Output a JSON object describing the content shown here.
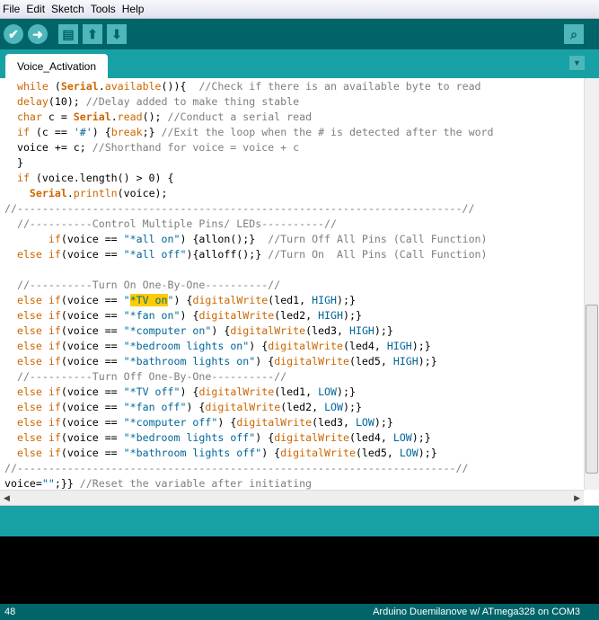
{
  "menu": [
    "File",
    "Edit",
    "Sketch",
    "Tools",
    "Help"
  ],
  "toolbar": {
    "verify": "✔",
    "upload": "➜",
    "new": "▤",
    "open": "⬆",
    "save": "⬇",
    "serial_monitor": "⌕"
  },
  "tab": {
    "label": "Voice_Activation",
    "menu_arrow": "▼"
  },
  "editor": {
    "lines": [
      [
        [
          "n",
          "  "
        ],
        [
          "k",
          "while"
        ],
        [
          "n",
          " ("
        ],
        [
          "b",
          "Serial"
        ],
        [
          "n",
          "."
        ],
        [
          "k",
          "available"
        ],
        [
          "n",
          "()){  "
        ],
        [
          "c",
          "//Check if there is an available byte to read"
        ]
      ],
      [
        [
          "n",
          "  "
        ],
        [
          "k",
          "delay"
        ],
        [
          "n",
          "(10); "
        ],
        [
          "c",
          "//Delay added to make thing stable"
        ]
      ],
      [
        [
          "n",
          "  "
        ],
        [
          "k",
          "char"
        ],
        [
          "n",
          " c = "
        ],
        [
          "b",
          "Serial"
        ],
        [
          "n",
          "."
        ],
        [
          "k",
          "read"
        ],
        [
          "n",
          "(); "
        ],
        [
          "c",
          "//Conduct a serial read"
        ]
      ],
      [
        [
          "n",
          "  "
        ],
        [
          "k",
          "if"
        ],
        [
          "n",
          " (c == "
        ],
        [
          "s",
          "'#'"
        ],
        [
          "n",
          ") {"
        ],
        [
          "k",
          "break"
        ],
        [
          "n",
          ";} "
        ],
        [
          "c",
          "//Exit the loop when the # is detected after the word"
        ]
      ],
      [
        [
          "n",
          "  voice += c; "
        ],
        [
          "c",
          "//Shorthand for voice = voice + c"
        ]
      ],
      [
        [
          "n",
          "  }"
        ]
      ],
      [
        [
          "n",
          "  "
        ],
        [
          "k",
          "if"
        ],
        [
          "n",
          " (voice.length() > 0) {"
        ]
      ],
      [
        [
          "n",
          "    "
        ],
        [
          "b",
          "Serial"
        ],
        [
          "n",
          "."
        ],
        [
          "k",
          "println"
        ],
        [
          "n",
          "(voice);"
        ]
      ],
      [
        [
          "c",
          "//-----------------------------------------------------------------------//"
        ]
      ],
      [
        [
          "n",
          "  "
        ],
        [
          "c",
          "//----------Control Multiple Pins/ LEDs----------//"
        ]
      ],
      [
        [
          "n",
          "       "
        ],
        [
          "k",
          "if"
        ],
        [
          "n",
          "(voice == "
        ],
        [
          "s",
          "\"*all on\""
        ],
        [
          "n",
          ") {allon();}  "
        ],
        [
          "c",
          "//Turn Off All Pins (Call Function)"
        ]
      ],
      [
        [
          "n",
          "  "
        ],
        [
          "k",
          "else if"
        ],
        [
          "n",
          "(voice == "
        ],
        [
          "s",
          "\"*all off\""
        ],
        [
          "n",
          "){alloff();} "
        ],
        [
          "c",
          "//Turn On  All Pins (Call Function)"
        ]
      ],
      [
        [
          "n",
          ""
        ]
      ],
      [
        [
          "n",
          "  "
        ],
        [
          "c",
          "//----------Turn On One-By-One----------//"
        ]
      ],
      [
        [
          "n",
          "  "
        ],
        [
          "k",
          "else if"
        ],
        [
          "n",
          "(voice == "
        ],
        [
          "s",
          "\""
        ],
        [
          "h",
          "*TV on"
        ],
        [
          "s",
          "\""
        ],
        [
          "n",
          ") {"
        ],
        [
          "k",
          "digitalWrite"
        ],
        [
          "n",
          "(led1, "
        ],
        [
          "s",
          "HIGH"
        ],
        [
          "n",
          ");}"
        ]
      ],
      [
        [
          "n",
          "  "
        ],
        [
          "k",
          "else if"
        ],
        [
          "n",
          "(voice == "
        ],
        [
          "s",
          "\"*fan on\""
        ],
        [
          "n",
          ") {"
        ],
        [
          "k",
          "digitalWrite"
        ],
        [
          "n",
          "(led2, "
        ],
        [
          "s",
          "HIGH"
        ],
        [
          "n",
          ");}"
        ]
      ],
      [
        [
          "n",
          "  "
        ],
        [
          "k",
          "else if"
        ],
        [
          "n",
          "(voice == "
        ],
        [
          "s",
          "\"*computer on\""
        ],
        [
          "n",
          ") {"
        ],
        [
          "k",
          "digitalWrite"
        ],
        [
          "n",
          "(led3, "
        ],
        [
          "s",
          "HIGH"
        ],
        [
          "n",
          ");}"
        ]
      ],
      [
        [
          "n",
          "  "
        ],
        [
          "k",
          "else if"
        ],
        [
          "n",
          "(voice == "
        ],
        [
          "s",
          "\"*bedroom lights on\""
        ],
        [
          "n",
          ") {"
        ],
        [
          "k",
          "digitalWrite"
        ],
        [
          "n",
          "(led4, "
        ],
        [
          "s",
          "HIGH"
        ],
        [
          "n",
          ");}"
        ]
      ],
      [
        [
          "n",
          "  "
        ],
        [
          "k",
          "else if"
        ],
        [
          "n",
          "(voice == "
        ],
        [
          "s",
          "\"*bathroom lights on\""
        ],
        [
          "n",
          ") {"
        ],
        [
          "k",
          "digitalWrite"
        ],
        [
          "n",
          "(led5, "
        ],
        [
          "s",
          "HIGH"
        ],
        [
          "n",
          ");}"
        ]
      ],
      [
        [
          "n",
          "  "
        ],
        [
          "c",
          "//----------Turn Off One-By-One----------//"
        ]
      ],
      [
        [
          "n",
          "  "
        ],
        [
          "k",
          "else if"
        ],
        [
          "n",
          "(voice == "
        ],
        [
          "s",
          "\"*TV off\""
        ],
        [
          "n",
          ") {"
        ],
        [
          "k",
          "digitalWrite"
        ],
        [
          "n",
          "(led1, "
        ],
        [
          "s",
          "LOW"
        ],
        [
          "n",
          ");}"
        ]
      ],
      [
        [
          "n",
          "  "
        ],
        [
          "k",
          "else if"
        ],
        [
          "n",
          "(voice == "
        ],
        [
          "s",
          "\"*fan off\""
        ],
        [
          "n",
          ") {"
        ],
        [
          "k",
          "digitalWrite"
        ],
        [
          "n",
          "(led2, "
        ],
        [
          "s",
          "LOW"
        ],
        [
          "n",
          ");}"
        ]
      ],
      [
        [
          "n",
          "  "
        ],
        [
          "k",
          "else if"
        ],
        [
          "n",
          "(voice == "
        ],
        [
          "s",
          "\"*computer off\""
        ],
        [
          "n",
          ") {"
        ],
        [
          "k",
          "digitalWrite"
        ],
        [
          "n",
          "(led3, "
        ],
        [
          "s",
          "LOW"
        ],
        [
          "n",
          ");}"
        ]
      ],
      [
        [
          "n",
          "  "
        ],
        [
          "k",
          "else if"
        ],
        [
          "n",
          "(voice == "
        ],
        [
          "s",
          "\"*bedroom lights off\""
        ],
        [
          "n",
          ") {"
        ],
        [
          "k",
          "digitalWrite"
        ],
        [
          "n",
          "(led4, "
        ],
        [
          "s",
          "LOW"
        ],
        [
          "n",
          ");}"
        ]
      ],
      [
        [
          "n",
          "  "
        ],
        [
          "k",
          "else if"
        ],
        [
          "n",
          "(voice == "
        ],
        [
          "s",
          "\"*bathroom lights off\""
        ],
        [
          "n",
          ") {"
        ],
        [
          "k",
          "digitalWrite"
        ],
        [
          "n",
          "(led5, "
        ],
        [
          "s",
          "LOW"
        ],
        [
          "n",
          ");}"
        ]
      ],
      [
        [
          "c",
          "//----------------------------------------------------------------------//"
        ]
      ],
      [
        [
          "n",
          "voice="
        ],
        [
          "s",
          "\"\""
        ],
        [
          "n",
          ";}} "
        ],
        [
          "c",
          "//Reset the variable after initiating"
        ]
      ]
    ]
  },
  "scroll": {
    "left": "◀",
    "right": "▶",
    "vertical_position_percent": 55
  },
  "status": {
    "line": "48",
    "board": "Arduino Duemilanove w/ ATmega328 on COM3"
  },
  "colors": {
    "toolbar": "#006468",
    "tabbar": "#17a1a5",
    "keyword": "#cc6600",
    "literal": "#006699",
    "comment": "#7e7e7e",
    "highlight": "#ffcc00"
  }
}
